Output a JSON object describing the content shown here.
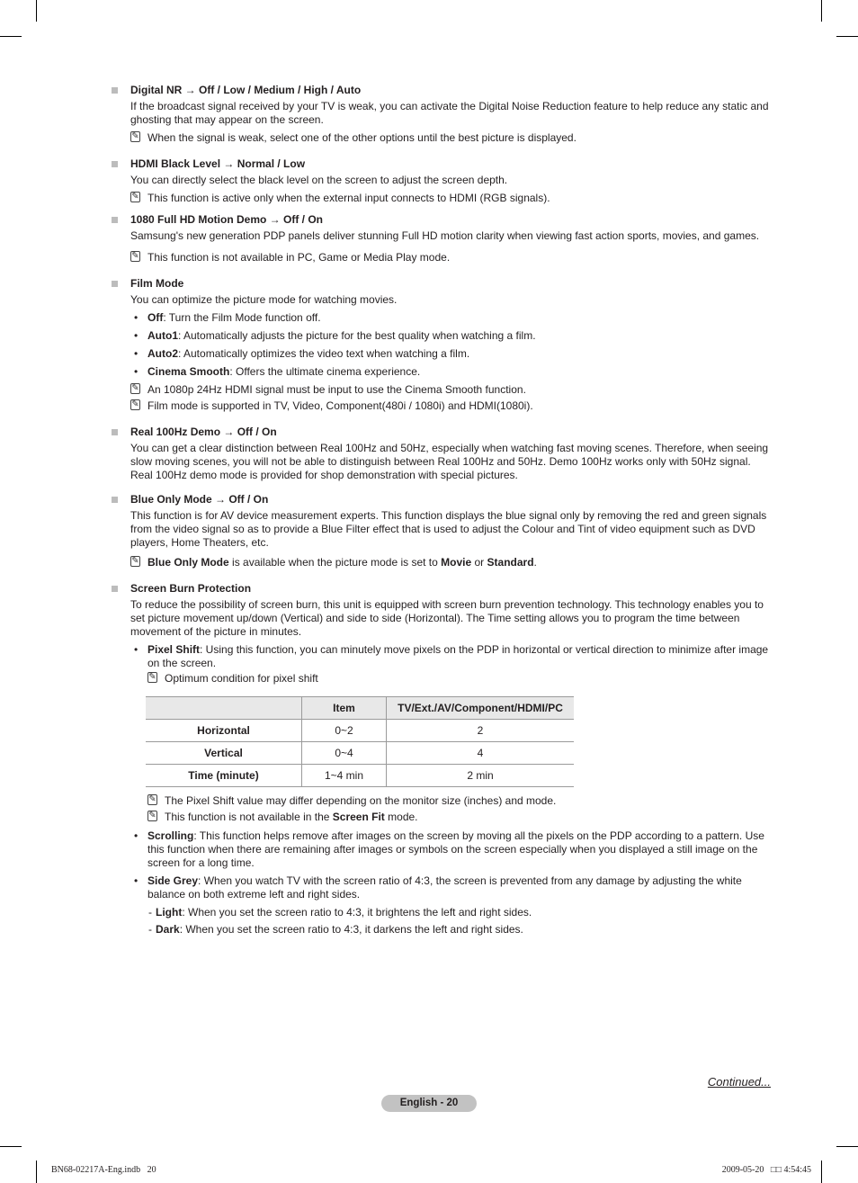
{
  "sections": [
    {
      "title": "Digital NR → Off / Low / Medium / High / Auto",
      "body": "If the broadcast signal received by your TV is weak, you can activate the Digital Noise Reduction feature to help reduce any static and ghosting that may appear on the screen.",
      "notes": [
        "When the signal is weak, select one of the other options until the best picture is displayed."
      ]
    },
    {
      "title": "HDMI Black Level → Normal / Low",
      "body": "You can directly select the black level on the screen to adjust the screen depth.",
      "notes": [
        "This function is active only when the external input connects to HDMI (RGB signals)."
      ]
    },
    {
      "title": "1080 Full HD Motion Demo → Off / On",
      "body": "Samsung's new generation PDP panels deliver stunning Full HD motion clarity when viewing fast action sports, movies, and games.",
      "notes": [
        "This function is not available in PC, Game or Media Play mode."
      ]
    },
    {
      "title": "Film Mode",
      "body": "You can optimize the picture mode for watching movies.",
      "bullets": [
        {
          "term": "Off",
          "text": ": Turn the Film Mode function off."
        },
        {
          "term": "Auto1",
          "text": ": Automatically adjusts the picture for the best quality when watching a film."
        },
        {
          "term": "Auto2",
          "text": ": Automatically optimizes the video text when watching a film."
        },
        {
          "term": "Cinema Smooth",
          "text": ": Offers the ultimate cinema experience."
        }
      ],
      "notes": [
        "An 1080p 24Hz HDMI signal must be input to use the Cinema Smooth function.",
        "Film mode is supported in TV, Video, Component(480i / 1080i) and HDMI(1080i)."
      ]
    },
    {
      "title": "Real 100Hz Demo → Off / On",
      "body": "You can get a clear distinction between Real 100Hz and 50Hz, especially when watching fast moving scenes. Therefore, when seeing slow moving scenes, you will not be able to distinguish between Real 100Hz and 50Hz. Demo 100Hz works only with 50Hz signal. Real 100Hz demo mode is provided for shop demonstration with special pictures."
    },
    {
      "title": "Blue Only Mode → Off / On",
      "body": "This function is for AV device measurement experts. This function displays the blue signal only by removing the red and green signals from the video signal so as to provide a Blue Filter effect that is used to adjust the Colour and Tint of video equipment such as DVD players, Home Theaters, etc.",
      "note_rich": {
        "b1": "Blue Only Mode",
        "t1": " is available when the picture mode is set to ",
        "b2": "Movie",
        "t2": " or ",
        "b3": "Standard",
        "t3": "."
      }
    },
    {
      "title": "Screen Burn Protection",
      "body": "To reduce the possibility of screen burn, this unit is equipped with screen burn prevention technology. This technology enables you to set picture movement up/down (Vertical) and side to side (Horizontal). The Time setting allows you to program the time between movement of the picture in minutes.",
      "pixel_shift": {
        "term": "Pixel Shift",
        "text": ": Using this function, you can minutely move pixels on the PDP in horizontal or vertical direction to minimize after image on the screen.",
        "note": "Optimum condition for pixel shift",
        "table": {
          "headers": [
            "",
            "Item",
            "TV/Ext./AV/Component/HDMI/PC"
          ],
          "rows": [
            [
              "Horizontal",
              "0~2",
              "2"
            ],
            [
              "Vertical",
              "0~4",
              "4"
            ],
            [
              "Time (minute)",
              "1~4 min",
              "2 min"
            ]
          ]
        },
        "note2": "The Pixel Shift value may differ depending on the monitor size (inches) and mode.",
        "note3": {
          "t1": "This function is not available in the ",
          "b1": "Screen Fit",
          "t2": " mode."
        }
      },
      "scrolling": {
        "term": "Scrolling",
        "text": ": This function helps remove after images on the screen by moving all the pixels on the PDP according to a pattern. Use this function when there are remaining after images or symbols on the screen especially when you displayed a still image on the screen for a long time."
      },
      "side_grey": {
        "term": "Side Grey",
        "text": ": When you watch TV with the screen ratio of 4:3, the screen is prevented from any damage by adjusting the white balance on both extreme left and right sides.",
        "options": [
          {
            "term": "Light",
            "text": ": When you set the screen ratio to 4:3, it brightens the left and right sides."
          },
          {
            "term": "Dark",
            "text": ": When you set the screen ratio to 4:3, it darkens the left and right sides."
          }
        ]
      }
    }
  ],
  "symbols": {
    "bullet": "•",
    "dash": "-",
    "note_icon": "✎"
  },
  "continued": "Continued...",
  "page_label": "English - 20",
  "footer": {
    "left": "BN68-02217A-Eng.indb   20",
    "right": "2009-05-20   □□ 4:54:45"
  }
}
